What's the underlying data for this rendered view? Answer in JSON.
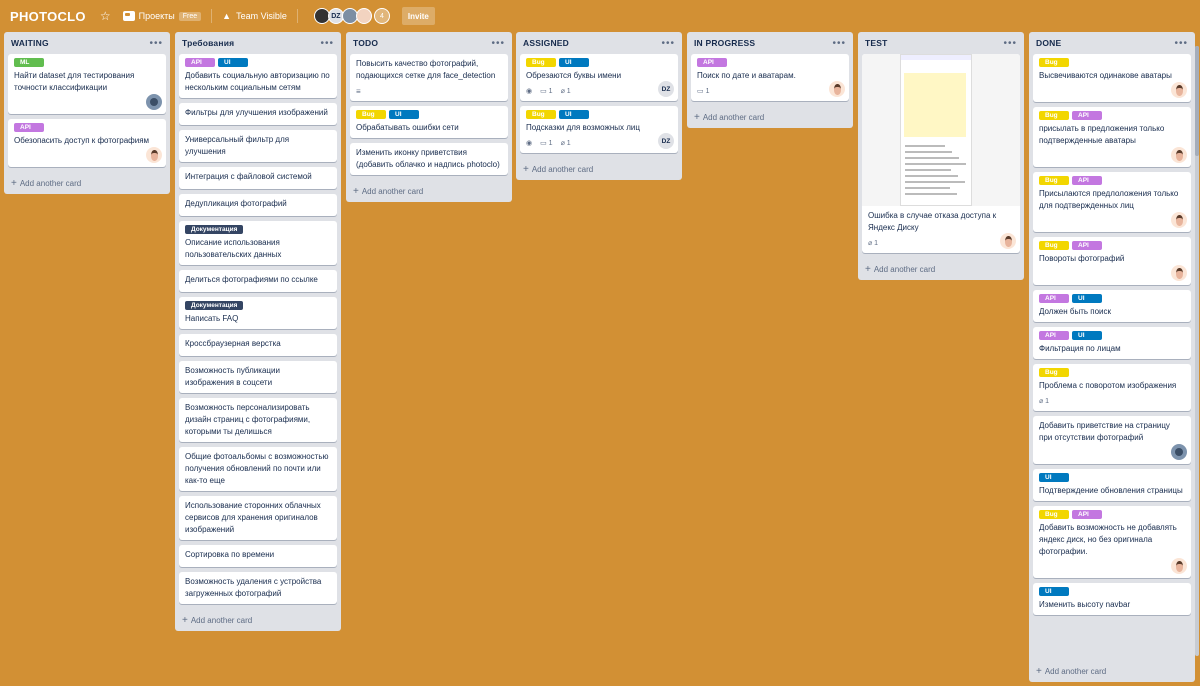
{
  "header": {
    "board_title": "PHOTOCLO",
    "team_label": "Проекты",
    "free_badge": "Free",
    "visibility_label": "Team Visible",
    "member_initials": "DZ",
    "member_count": "4",
    "invite_label": "Invite"
  },
  "add_card_label": "Add another card",
  "lists": [
    {
      "title": "WAITING",
      "cards": [
        {
          "labels": [
            "ML"
          ],
          "title": "Найти dataset для тестирования точности классификации",
          "avatar": "photo"
        },
        {
          "labels": [
            "API"
          ],
          "title": "Обезопасить доступ к фотографиям",
          "avatar": "face"
        }
      ]
    },
    {
      "title": "Требования",
      "cards": [
        {
          "labels": [
            "API",
            "UI"
          ],
          "title": "Добавить социальную авторизацию по нескольким социальным сетям"
        },
        {
          "title": "Фильтры для улучшения изображений"
        },
        {
          "title": "Универсальный фильтр для улучшения"
        },
        {
          "title": "Интеграция с файловой системой"
        },
        {
          "title": "Дедупликация фотографий"
        },
        {
          "labels": [
            "Документация"
          ],
          "title": "Описание использования пользовательских данных"
        },
        {
          "title": "Делиться фотографиями по ссылке"
        },
        {
          "labels": [
            "Документация"
          ],
          "title": "Написать FAQ"
        },
        {
          "title": "Кроссбраузерная верстка"
        },
        {
          "title": "Возможность публикации изображения в соцсети"
        },
        {
          "title": "Возможность персонализировать дизайн страниц с фотографиями, которыми ты делишься"
        },
        {
          "title": "Общие фотоальбомы с возможностью получения обновлений по почти или как-то еще"
        },
        {
          "title": "Использование сторонних облачных сервисов для хранения оригиналов изображений"
        },
        {
          "title": "Сортировка по времени"
        },
        {
          "title": "Возможность удаления с устройства загруженных фотографий"
        }
      ]
    },
    {
      "title": "TODO",
      "cards": [
        {
          "title": "Повысить качество фотографий, подающихся сетке для face_detection",
          "description": true
        },
        {
          "labels": [
            "Bug",
            "UI"
          ],
          "title": "Обрабатывать ошибки сети"
        },
        {
          "title": "Изменить иконку приветствия (добавить облачко и надпись photoclo)"
        }
      ]
    },
    {
      "title": "ASSIGNED",
      "cards": [
        {
          "labels": [
            "Bug",
            "UI"
          ],
          "title": "Обрезаются буквы имени",
          "watch": true,
          "comments": "1",
          "attachments": "1",
          "avatar": "dz"
        },
        {
          "labels": [
            "Bug",
            "UI"
          ],
          "title": "Подсказки для возможных лиц",
          "watch": true,
          "comments": "1",
          "attachments": "1",
          "avatar": "dz"
        }
      ]
    },
    {
      "title": "IN PROGRESS",
      "cards": [
        {
          "labels": [
            "API"
          ],
          "title": "Поиск по дате и аватарам.",
          "comments": "1",
          "avatar": "face"
        }
      ]
    },
    {
      "title": "TEST",
      "cards": [
        {
          "cover": true,
          "title": "Ошибка в случае отказа доступа к Яндекс Диску",
          "attachments": "1",
          "avatar": "face"
        }
      ]
    },
    {
      "title": "DONE",
      "cards": [
        {
          "labels": [
            "Bug"
          ],
          "title": "Высвечиваются одинакове аватары",
          "avatar": "face"
        },
        {
          "labels": [
            "Bug",
            "API"
          ],
          "title": "присылать в предложения только подтвержденные аватары",
          "avatar": "face"
        },
        {
          "labels": [
            "Bug",
            "API"
          ],
          "title": "Присылаются предлоложения только для подтвержденных лиц",
          "avatar": "face"
        },
        {
          "labels": [
            "Bug",
            "API"
          ],
          "title": "Повороты фотографий",
          "avatar": "face"
        },
        {
          "labels": [
            "API",
            "UI"
          ],
          "title": "Должен быть поиск"
        },
        {
          "labels": [
            "API",
            "UI"
          ],
          "title": "Фильтрация по лицам"
        },
        {
          "labels": [
            "Bug"
          ],
          "title": "Проблема с поворотом изображения",
          "attachments": "1"
        },
        {
          "title": "Добавить приветствие на страницу при отсутствии фотографий",
          "avatar": "photo"
        },
        {
          "labels": [
            "UI"
          ],
          "title": "Подтверждение обновления страницы"
        },
        {
          "labels": [
            "Bug",
            "API"
          ],
          "title": "Добавить возможность не добавлять яндекс диск, но без оригинала фотографии.",
          "avatar": "face"
        },
        {
          "labels": [
            "UI"
          ],
          "title": "Изменить высоту navbar"
        }
      ]
    }
  ],
  "colors": {
    "background": "#d29034",
    "list": "#dfe1e6",
    "label_ml": "#61bd4f",
    "label_api": "#c377e0",
    "label_ui": "#0079bf",
    "label_bug": "#f2d600",
    "label_doc": "#344563"
  }
}
